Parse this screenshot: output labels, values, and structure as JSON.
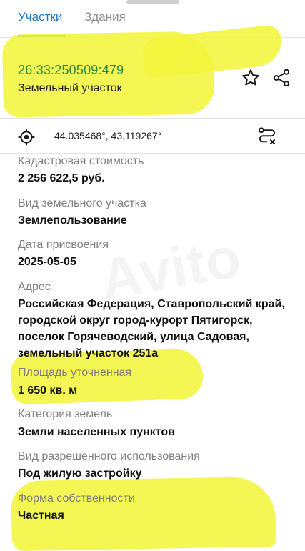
{
  "tabs": [
    {
      "label": "Участки",
      "active": true
    },
    {
      "label": "Здания",
      "active": false
    }
  ],
  "parcel": {
    "cadastral_number": "26:33:250509:479",
    "type": "Земельный участок"
  },
  "location": {
    "coordinates": "44.035468°, 43.119267°"
  },
  "fields": [
    {
      "label": "Кадастровая стоимость",
      "value": "2 256 622,5 руб."
    },
    {
      "label": "Вид земельного участка",
      "value": "Землепользование"
    },
    {
      "label": "Дата присвоения",
      "value": "2025-05-05"
    },
    {
      "label": "Адрес",
      "value": "Российская Федерация, Ставропольский край, городской округ город-курорт Пятигорск, поселок Горячеводский, улица Садовая, земельный участок 251а"
    },
    {
      "label": "Площадь уточненная",
      "value": "1 650 кв. м"
    },
    {
      "label": "Категория земель",
      "value": "Земли населенных пунктов"
    },
    {
      "label": "Вид разрешенного использования",
      "value": "Под жилую застройку"
    },
    {
      "label": "Форма собственности",
      "value": "Частная"
    }
  ],
  "icons": [
    "star-icon",
    "share-icon",
    "target-icon",
    "route-icon"
  ],
  "colors": {
    "accent": "#1f78c2",
    "cadastral_number": "#2b8a3e",
    "highlighter": "#f3f53c"
  }
}
